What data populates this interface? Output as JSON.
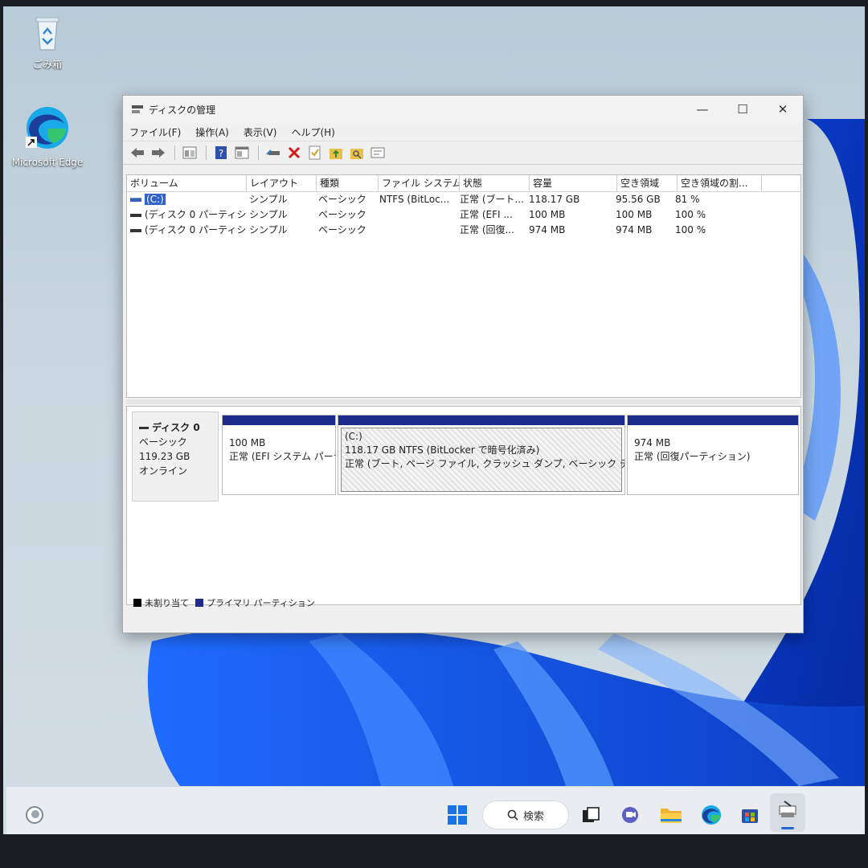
{
  "desktop": {
    "icons": [
      {
        "label": "ごみ箱",
        "icon": "recycle-bin-icon"
      },
      {
        "label": "Microsoft Edge",
        "icon": "edge-icon"
      }
    ]
  },
  "window": {
    "title": "ディスクの管理",
    "controls": {
      "minimize": "—",
      "maximize": "☐",
      "close": "✕"
    },
    "menu": [
      "ファイル(F)",
      "操作(A)",
      "表示(V)",
      "ヘルプ(H)"
    ],
    "toolbar_icons": [
      "back-arrow-icon",
      "forward-arrow-icon",
      "view-icon",
      "help-icon",
      "console-icon",
      "connect-drive-icon",
      "delete-icon",
      "check-icon",
      "folder-up-icon",
      "search-folder-icon",
      "properties-icon"
    ]
  },
  "volume_list": {
    "columns": [
      "ボリューム",
      "レイアウト",
      "種類",
      "ファイル システム",
      "状態",
      "容量",
      "空き領域",
      "空き領域の割..."
    ],
    "rows": [
      {
        "volume": "(C:)",
        "layout": "シンプル",
        "type": "ベーシック",
        "fs": "NTFS (BitLoc...",
        "status": "正常 (ブート...",
        "capacity": "118.17 GB",
        "free": "95.56 GB",
        "pct": "81 %",
        "selected": true
      },
      {
        "volume": "(ディスク 0 パーティショ...",
        "layout": "シンプル",
        "type": "ベーシック",
        "fs": "",
        "status": "正常 (EFI ...",
        "capacity": "100 MB",
        "free": "100 MB",
        "pct": "100 %",
        "selected": false
      },
      {
        "volume": "(ディスク 0 パーティショ...",
        "layout": "シンプル",
        "type": "ベーシック",
        "fs": "",
        "status": "正常 (回復...",
        "capacity": "974 MB",
        "free": "974 MB",
        "pct": "100 %",
        "selected": false
      }
    ]
  },
  "disk": {
    "name": "ディスク 0",
    "type": "ベーシック",
    "size": "119.23 GB",
    "state": "オンライン",
    "partitions": [
      {
        "line1": "",
        "line2": "100 MB",
        "line3": "正常 (EFI システム パーテ"
      },
      {
        "line1": "(C:)",
        "line2": "118.17 GB NTFS (BitLocker で暗号化済み)",
        "line3": "正常 (ブート, ページ ファイル, クラッシュ ダンプ, ベーシック データ パーティ"
      },
      {
        "line1": "",
        "line2": "974 MB",
        "line3": "正常 (回復パーティション)"
      }
    ]
  },
  "legend": [
    {
      "label": "未割り当て",
      "color": "#000000"
    },
    {
      "label": "プライマリ パーティション",
      "color": "#1d2b8a"
    }
  ],
  "taskbar": {
    "search_label": "検索",
    "icons": [
      "widgets-icon",
      "start-icon",
      "task-view-icon",
      "chat-icon",
      "file-explorer-icon",
      "edge-icon",
      "store-icon",
      "disk-management-icon"
    ]
  },
  "colors": {
    "primary_partition": "#1d2b8a",
    "selection": "#2f63c8",
    "accent": "#2367d1"
  }
}
